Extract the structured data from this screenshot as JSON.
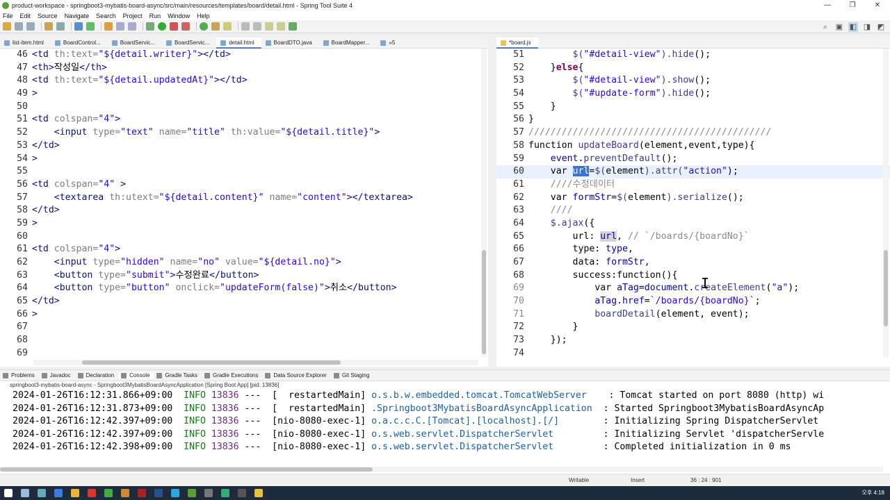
{
  "window": {
    "title": "product-workspace - springboot3-mybatis-board-async/src/main/resources/templates/board/detail.html - Spring Tool Suite 4",
    "controls": [
      "—",
      "❐",
      "✕"
    ]
  },
  "menu": [
    "File",
    "Edit",
    "Source",
    "Navigate",
    "Search",
    "Project",
    "Run",
    "Window",
    "Help"
  ],
  "left_tabs": [
    "list-item.html",
    "BoardControl...",
    "BoardServic...",
    "BoardServic...",
    "detail.html",
    "BoardDTO.java",
    "BoardMapper...",
    "»5"
  ],
  "right_tabs": [
    "*board.js"
  ],
  "left_code": [
    {
      "n": "46",
      "html": "<span class='t'>&lt;td</span> <span class='a'>th:text=</span><span class='s'>\"${detail.writer}\"</span><span class='t'>&gt;&lt;/td&gt;</span>"
    },
    {
      "n": "47",
      "html": "<span class='t'>&lt;th&gt;</span>작성일<span class='t'>&lt;/th&gt;</span>"
    },
    {
      "n": "48",
      "html": "<span class='t'>&lt;td</span> <span class='a'>th:text=</span><span class='s'>\"${detail.updatedAt}\"</span><span class='t'>&gt;&lt;/td&gt;</span>"
    },
    {
      "n": "49",
      "html": "<span class='t'>&gt;</span>",
      "fold": true
    },
    {
      "n": "50",
      "html": ""
    },
    {
      "n": "51",
      "html": "<span class='t'>&lt;td</span> <span class='a'>colspan=</span><span class='s'>\"4\"</span><span class='t'>&gt;</span>"
    },
    {
      "n": "52",
      "html": "    <span class='t'>&lt;input</span> <span class='a'>type=</span><span class='s'>\"text\"</span> <span class='a'>name=</span><span class='s'>\"title\"</span> <span class='a'>th:value=</span><span class='s'>\"${detail.title}\"</span><span class='t'>&gt;</span>"
    },
    {
      "n": "53",
      "html": "<span class='t'>&lt;/td&gt;</span>"
    },
    {
      "n": "54",
      "html": "<span class='t'>&gt;</span>",
      "fold": true
    },
    {
      "n": "55",
      "html": ""
    },
    {
      "n": "56",
      "html": "<span class='t'>&lt;td</span> <span class='a'>colspan=</span><span class='s'>\"4\"</span> <span class='t'>&gt;</span>"
    },
    {
      "n": "57",
      "html": "    <span class='t'>&lt;textarea</span> <span class='a'>th:utext=</span><span class='s'>\"${detail.content}\"</span> <span class='a'>name=</span><span class='s'>\"content\"</span><span class='t'>&gt;&lt;/textarea&gt;</span>"
    },
    {
      "n": "58",
      "html": "<span class='t'>&lt;/td&gt;</span>"
    },
    {
      "n": "59",
      "html": "<span class='t'>&gt;</span>",
      "fold": true
    },
    {
      "n": "60",
      "html": ""
    },
    {
      "n": "61",
      "html": "<span class='t'>&lt;td</span> <span class='a'>colspan=</span><span class='s'>\"4\"</span><span class='t'>&gt;</span>"
    },
    {
      "n": "62",
      "html": "    <span class='t'>&lt;input</span> <span class='a'>type=</span><span class='s'>\"hidden\"</span> <span class='a'>name=</span><span class='s'>\"no\"</span> <span class='a'>value=</span><span class='s'>\"${detail.no}\"</span><span class='t'>&gt;</span>"
    },
    {
      "n": "63",
      "html": "    <span class='t'>&lt;button</span> <span class='a'>type=</span><span class='s'>\"submit\"</span><span class='t'>&gt;</span>수정완료<span class='t'>&lt;/button&gt;</span>"
    },
    {
      "n": "64",
      "html": "    <span class='t'>&lt;button</span> <span class='a'>type=</span><span class='s'>\"button\"</span> <span class='a'>onclick=</span><span class='s'>\"updateForm(false)\"</span><span class='t'>&gt;</span>취소<span class='t'>&lt;/button&gt;</span>"
    },
    {
      "n": "65",
      "html": "<span class='t'>&lt;/td&gt;</span>"
    },
    {
      "n": "66",
      "html": "<span class='t'>&gt;</span>",
      "fold": true
    },
    {
      "n": "67",
      "html": ""
    },
    {
      "n": "68",
      "html": ""
    },
    {
      "n": "69",
      "html": ""
    }
  ],
  "right_code": [
    {
      "n": "51",
      "html": "        <span class='f'>$(</span><span class='str'>\"#detail-view\"</span><span class='f'>).hide</span>();"
    },
    {
      "n": "52",
      "html": "    }<span class='k'>else</span>{"
    },
    {
      "n": "53",
      "html": "        <span class='f'>$(</span><span class='str'>\"#detail-view\"</span><span class='f'>).show</span>();"
    },
    {
      "n": "54",
      "html": "        <span class='f'>$(</span><span class='str'>\"#update-form\"</span><span class='f'>).hide</span>();"
    },
    {
      "n": "55",
      "html": "    }"
    },
    {
      "n": "56",
      "html": "}"
    },
    {
      "n": "57",
      "html": "<span class='c'>////////////////////////////////////////////</span>"
    },
    {
      "n": "58",
      "html": "<span class='kw'>function</span> <span class='f'>updateBoard</span>(element,event,type){"
    },
    {
      "n": "59",
      "html": "    <span class='v'>event</span>.<span class='f'>preventDefault</span>();"
    },
    {
      "n": "60",
      "html": "    <span class='kw'>var</span> <span class='sel'>url</span>=<span class='f'>$(</span>element<span class='f'>).attr(</span><span class='str'>\"action\"</span>);",
      "cur": true
    },
    {
      "n": "61",
      "html": "    <span class='c'>////수정데이터</span>"
    },
    {
      "n": "62",
      "html": "    <span class='kw'>var</span> <span class='v'>formStr</span>=<span class='f'>$(</span>element<span class='f'>).serialize</span>();"
    },
    {
      "n": "63",
      "html": "    <span class='c'>////</span>"
    },
    {
      "n": "64",
      "html": "    <span class='f'>$.ajax</span>({"
    },
    {
      "n": "65",
      "html": "        url: <span class='mark v'>url</span>, <span class='c'>// `/boards/{boardNo}`</span>"
    },
    {
      "n": "66",
      "html": "        type: <span class='v'>type</span>,"
    },
    {
      "n": "67",
      "html": "        data: <span class='v'>formStr</span>,"
    },
    {
      "n": "68",
      "html": "        success:<span class='kw'>function</span>(){"
    },
    {
      "n": "69",
      "html": "            <span class='kw'>var</span> <span class='v'>aTag</span>=<span class='v'>document</span>.<span class='f'>createElement</span>(<span class='str'>\"a\"</span>);",
      "mod": true
    },
    {
      "n": "70",
      "html": "            <span class='v'>aTag</span>.<span class='v'>href</span>=<span class='str'>`/boards/{boardNo}`</span>;",
      "mod": true
    },
    {
      "n": "71",
      "html": "            <span class='f'>boardDetail</span>(element, event);",
      "mod": true
    },
    {
      "n": "72",
      "html": "        }"
    },
    {
      "n": "73",
      "html": "    });"
    },
    {
      "n": "74",
      "html": ""
    }
  ],
  "console_tabs": [
    "Problems",
    "Javadoc",
    "Declaration",
    "Console",
    "Gradle Tasks",
    "Gradle Executions",
    "Data Source Explorer",
    "Git Staging"
  ],
  "console_info": "springboot3-mybatis-board-async - Springboot3MybatisBoardAsyncApplication [Spring Boot App] [pid: 13836]",
  "console_lines": [
    {
      "ts": "2024-01-26T16:12:31.866+09:00",
      "lvl": "INFO",
      "pid": "13836",
      "thr": "---  [  restartedMain]",
      "cls": "o.s.b.w.embedded.tomcat.TomcatWebServer  ",
      "msg": "  : Tomcat started on port 8080 (http) wi"
    },
    {
      "ts": "2024-01-26T16:12:31.873+09:00",
      "lvl": "INFO",
      "pid": "13836",
      "thr": "---  [  restartedMain]",
      "cls": ".Springboot3MybatisBoardAsyncApplication",
      "msg": "  : Started Springboot3MybatisBoardAsyncAp"
    },
    {
      "ts": "2024-01-26T16:12:42.397+09:00",
      "lvl": "INFO",
      "pid": "13836",
      "thr": "---  [nio-8080-exec-1]",
      "cls": "o.a.c.c.C.[Tomcat].[localhost].[/]      ",
      "msg": "  : Initializing Spring DispatcherServlet"
    },
    {
      "ts": "2024-01-26T16:12:42.397+09:00",
      "lvl": "INFO",
      "pid": "13836",
      "thr": "---  [nio-8080-exec-1]",
      "cls": "o.s.web.servlet.DispatcherServlet       ",
      "msg": "  : Initializing Servlet 'dispatcherServle"
    },
    {
      "ts": "2024-01-26T16:12:42.398+09:00",
      "lvl": "INFO",
      "pid": "13836",
      "thr": "---  [nio-8080-exec-1]",
      "cls": "o.s.web.servlet.DispatcherServlet       ",
      "msg": "  : Completed initialization in 0 ms"
    }
  ],
  "status": {
    "mode": "Writable",
    "insert": "Insert",
    "position": "36 : 24 : 901"
  },
  "tray": {
    "time": "오후 4:18"
  }
}
